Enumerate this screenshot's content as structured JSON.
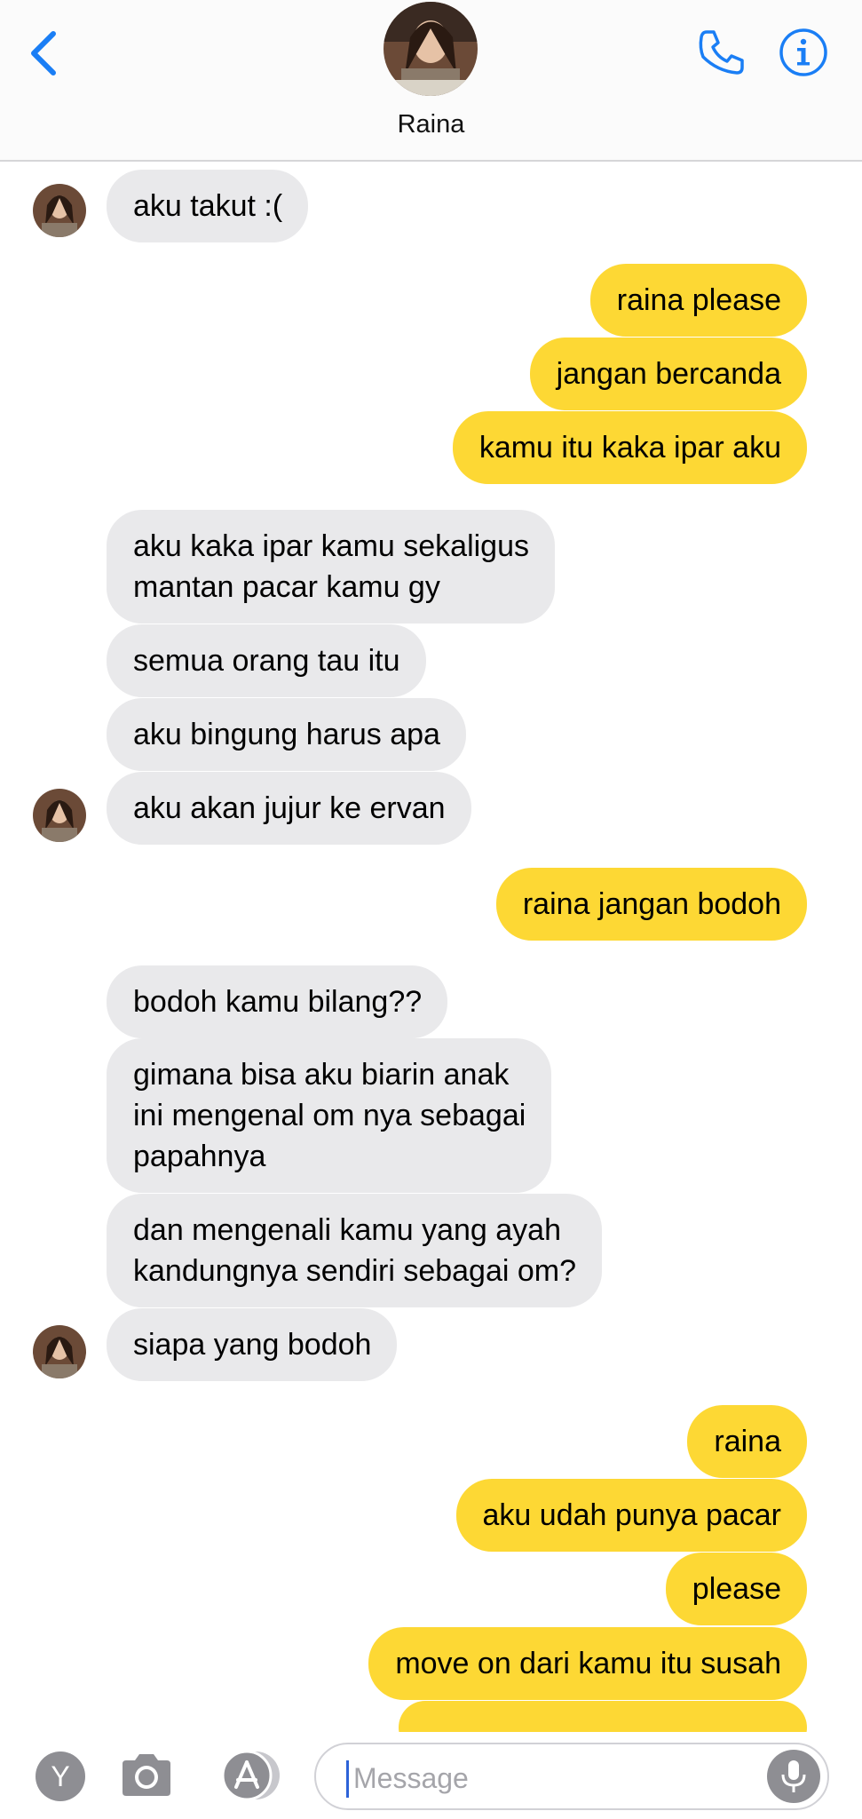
{
  "header": {
    "contact_name": "Raina",
    "icons": {
      "back": "chevron-left-icon",
      "call": "phone-icon",
      "info": "info-icon"
    },
    "accent_color": "#1a7ef5"
  },
  "messages": [
    {
      "side": "received",
      "text": "aku takut :("
    },
    {
      "side": "sent",
      "text": "raina please"
    },
    {
      "side": "sent",
      "text": "jangan bercanda"
    },
    {
      "side": "sent",
      "text": "kamu itu kaka ipar aku"
    },
    {
      "side": "received",
      "lines": [
        "aku kaka ipar kamu sekaligus",
        "mantan pacar kamu gy"
      ]
    },
    {
      "side": "received",
      "text": "semua orang tau itu"
    },
    {
      "side": "received",
      "text": "aku bingung harus apa"
    },
    {
      "side": "received",
      "text": "aku akan jujur ke ervan"
    },
    {
      "side": "sent",
      "text": "raina jangan bodoh"
    },
    {
      "side": "received",
      "text": "bodoh kamu bilang??"
    },
    {
      "side": "received",
      "lines": [
        "gimana bisa aku biarin anak",
        "ini mengenal om nya sebagai",
        "papahnya"
      ]
    },
    {
      "side": "received",
      "lines": [
        "dan mengenali kamu yang ayah",
        "kandungnya sendiri sebagai om?"
      ]
    },
    {
      "side": "received",
      "text": "siapa yang bodoh"
    },
    {
      "side": "sent",
      "text": "raina"
    },
    {
      "side": "sent",
      "text": "aku udah punya pacar"
    },
    {
      "side": "sent",
      "text": "please"
    },
    {
      "side": "sent",
      "text": "move on dari kamu itu susah"
    }
  ],
  "bubble_colors": {
    "received": "#e9e9eb",
    "sent": "#fdd834"
  },
  "composer": {
    "placeholder": "Message",
    "y_button_label": "Y",
    "icons": {
      "camera": "camera-icon",
      "appstore": "app-store-icon",
      "mic": "microphone-icon"
    }
  }
}
